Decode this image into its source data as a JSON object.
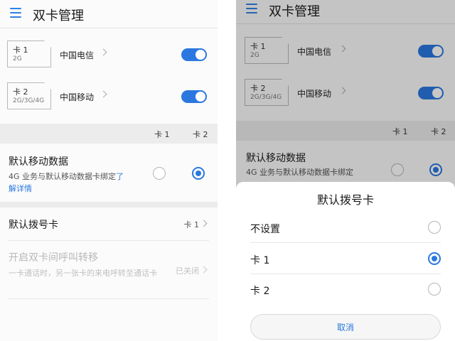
{
  "screen": {
    "title": "双卡管理",
    "sims": [
      {
        "name": "卡 1",
        "network": "2G",
        "carrier": "中国电信",
        "enabled": true
      },
      {
        "name": "卡 2",
        "network": "2G/3G/4G",
        "carrier": "中国移动",
        "enabled": true
      }
    ],
    "column_headers": {
      "card1": "卡 1",
      "card2": "卡 2"
    },
    "mobile_data": {
      "title": "默认移动数据",
      "description": "4G 业务与默认移动数据卡绑定",
      "link": "了解详情",
      "selected": "卡 2"
    },
    "default_dial": {
      "label": "默认拨号卡",
      "value": "卡 1"
    },
    "call_forwarding": {
      "title": "开启双卡间呼叫转移",
      "description": "一卡通话时，另一张卡的来电呼转至通话卡",
      "value": "已关闭"
    }
  },
  "dialog": {
    "title": "默认拨号卡",
    "options": [
      "不设置",
      "卡 1",
      "卡 2"
    ],
    "selected": "卡 1",
    "cancel_label": "取消"
  },
  "colors": {
    "accent": "#2a78df",
    "overlay": "rgba(0,0,0,0.22)"
  }
}
